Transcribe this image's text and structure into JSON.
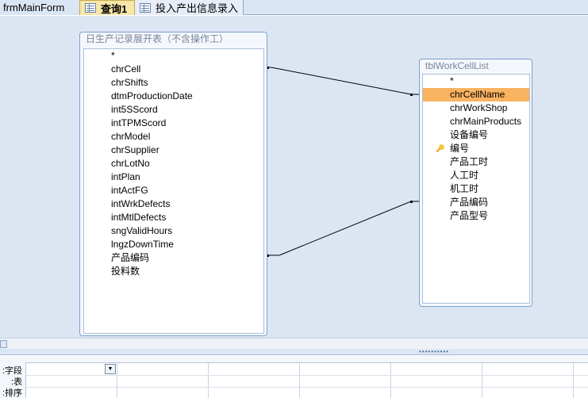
{
  "tabs": [
    {
      "label": "frmMainForm"
    },
    {
      "label": "查询1"
    },
    {
      "label": "投入产出信息录入"
    }
  ],
  "tables": {
    "left": {
      "title": "日生产记录展开表（不含操作工）",
      "fields": [
        "*",
        "chrCell",
        "chrShifts",
        "dtmProductionDate",
        "int5SScord",
        "intTPMScord",
        "chrModel",
        "chrSupplier",
        "chrLotNo",
        "intPlan",
        "intActFG",
        "intWrkDefects",
        "intMtlDefects",
        "sngValidHours",
        "lngzDownTime",
        "产品编码",
        "投料数"
      ]
    },
    "right": {
      "title": "tblWorkCellList",
      "fields": [
        "*",
        "chrCellName",
        "chrWorkShop",
        "chrMainProducts",
        "设备编号",
        "编号",
        "产品工时",
        "人工时",
        "机工时",
        "产品编码",
        "产品型号"
      ],
      "selected_field": "chrCellName",
      "key_field": "编号"
    }
  },
  "relationships": [
    {
      "from": "chrCell",
      "to": "chrCellName"
    },
    {
      "from": "产品编码",
      "to": "产品编码"
    }
  ],
  "qbe": {
    "row_labels": [
      "字段:",
      "表:",
      "排序:"
    ]
  },
  "icons": {
    "tab_query": "query-design-icon",
    "tab_form": "form-icon",
    "key": "primary-key-icon",
    "dropdown": "dropdown-arrow-icon"
  }
}
